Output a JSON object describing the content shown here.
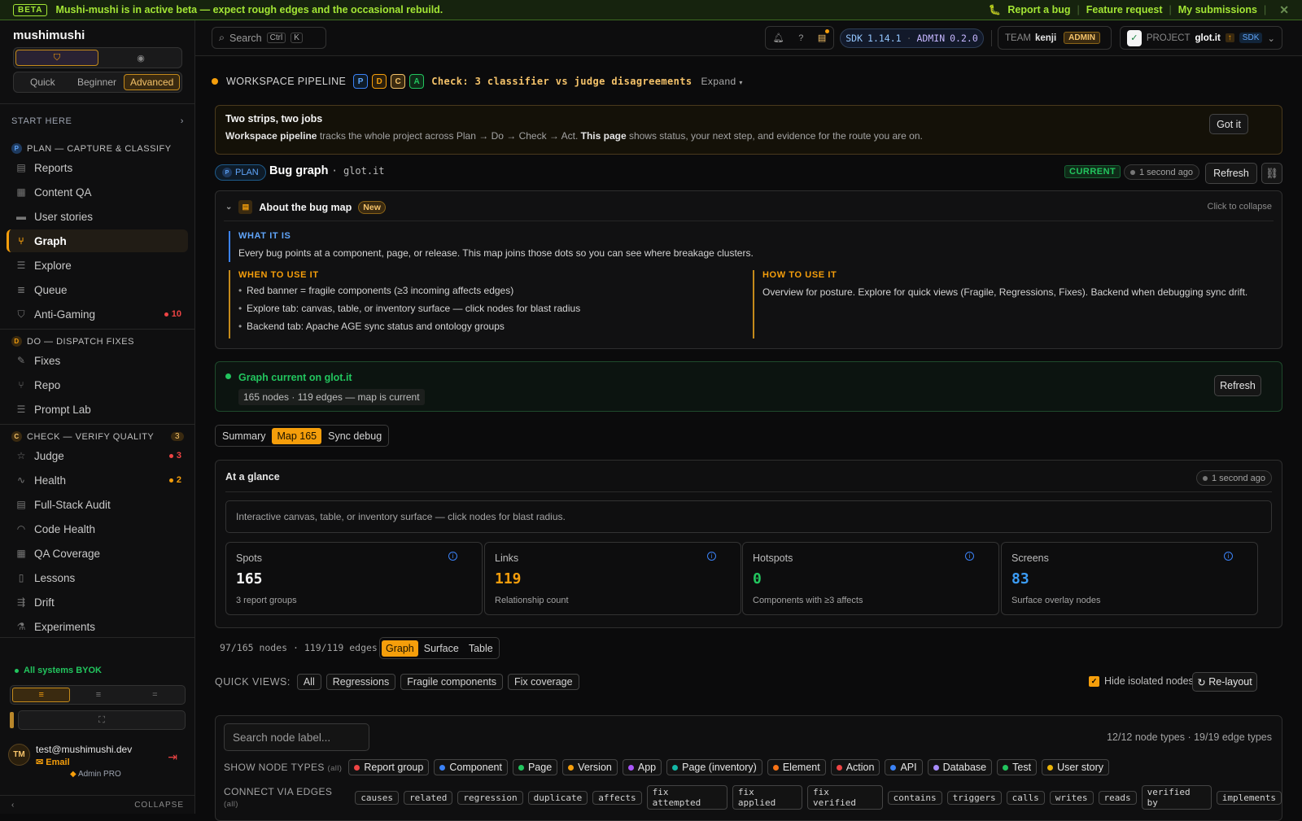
{
  "banner": {
    "tag": "BETA",
    "message": "Mushi-mushi is in active beta — expect rough edges and the occasional rebuild.",
    "links": [
      "Report a bug",
      "Feature request",
      "My submissions"
    ]
  },
  "sidebar": {
    "brand": "mushimushi",
    "difficulty": [
      "Quick",
      "Beginner",
      "Advanced"
    ],
    "start_here": "START HERE",
    "sections": [
      {
        "badge": "P",
        "label": "PLAN — CAPTURE & CLASSIFY",
        "items": [
          {
            "label": "Reports",
            "icon": "reports-icon"
          },
          {
            "label": "Content QA",
            "icon": "content-qa-icon"
          },
          {
            "label": "User stories",
            "icon": "user-stories-icon"
          },
          {
            "label": "Graph",
            "icon": "graph-icon",
            "active": true
          },
          {
            "label": "Explore",
            "icon": "explore-icon"
          },
          {
            "label": "Queue",
            "icon": "queue-icon"
          },
          {
            "label": "Anti-Gaming",
            "icon": "shield-icon",
            "count": "10",
            "count_color": "#ef4444"
          }
        ]
      },
      {
        "badge": "D",
        "label": "DO — DISPATCH FIXES",
        "items": [
          {
            "label": "Fixes",
            "icon": "wrench-icon"
          },
          {
            "label": "Repo",
            "icon": "branch-icon"
          },
          {
            "label": "Prompt Lab",
            "icon": "prompt-icon"
          }
        ]
      },
      {
        "badge": "C",
        "label": "CHECK — VERIFY QUALITY",
        "count": "3",
        "items": [
          {
            "label": "Judge",
            "icon": "star-icon",
            "count": "3",
            "count_color": "#ef4444"
          },
          {
            "label": "Health",
            "icon": "pulse-icon",
            "count": "2",
            "count_color": "#f59e0b"
          },
          {
            "label": "Full-Stack Audit",
            "icon": "audit-icon"
          },
          {
            "label": "Code Health",
            "icon": "gauge-icon"
          },
          {
            "label": "QA Coverage",
            "icon": "coverage-icon"
          },
          {
            "label": "Lessons",
            "icon": "book-icon"
          },
          {
            "label": "Drift",
            "icon": "drift-icon"
          },
          {
            "label": "Experiments",
            "icon": "flask-icon"
          }
        ]
      }
    ],
    "status": "All systems BYOK",
    "user": {
      "initials": "TM",
      "email": "test@mushimushi.dev",
      "provider": "Email",
      "plan": "Admin PRO"
    },
    "collapse": "COLLAPSE"
  },
  "topbar": {
    "search_label": "Search",
    "search_keys": [
      "Ctrl",
      "K"
    ],
    "sdk_label": "SDK",
    "sdk_version": "1.14.1",
    "admin_label": "ADMIN",
    "admin_version": "0.2.0",
    "team_label": "TEAM",
    "team_name": "kenji",
    "team_role": "ADMIN",
    "project_label": "PROJECT",
    "project_name": "glot.it",
    "project_sdk": "SDK"
  },
  "pipeline": {
    "label": "WORKSPACE PIPELINE",
    "stages": [
      "P",
      "D",
      "C",
      "A"
    ],
    "check_text": "Check: 3 classifier vs judge disagreements",
    "expand": "Expand"
  },
  "tip": {
    "title": "Two strips, two jobs",
    "b1": "Workspace pipeline",
    "t1": " tracks the whole project across Plan → Do → Check → Act. ",
    "b2": "This page",
    "t2": " shows status, your next step, and evidence for the route you are on.",
    "button": "Got it"
  },
  "page": {
    "plan_tag": "PLAN",
    "title": "Bug graph",
    "project": "· glot.it",
    "status": "CURRENT",
    "updated": "1 second ago",
    "refresh": "Refresh"
  },
  "about": {
    "title": "About the bug map",
    "badge": "New",
    "collapse_hint": "Click to collapse",
    "what_heading": "WHAT IT IS",
    "what_text": "Every bug points at a component, page, or release. This map joins those dots so you can see where breakage clusters.",
    "when_heading": "WHEN TO USE IT",
    "when_items": [
      "Red banner = fragile components (≥3 incoming affects edges)",
      "Explore tab: canvas, table, or inventory surface — click nodes for blast radius",
      "Backend tab: Apache AGE sync status and ontology groups"
    ],
    "how_heading": "HOW TO USE IT",
    "how_text": "Overview for posture. Explore for quick views (Fragile, Regressions, Fixes). Backend when debugging sync drift."
  },
  "graph_status": {
    "title": "Graph current on glot.it",
    "summary": "165 nodes · 119 edges — map is current",
    "refresh": "Refresh"
  },
  "tabs": [
    "Summary",
    "Map 165",
    "Sync debug"
  ],
  "glance": {
    "title": "At a glance",
    "updated": "1 second ago",
    "description": "Interactive canvas, table, or inventory surface — click nodes for blast radius.",
    "cards": [
      {
        "label": "Spots",
        "value": "165",
        "sub": "3 report groups",
        "color": "#f5f5f5"
      },
      {
        "label": "Links",
        "value": "119",
        "sub": "Relationship count",
        "color": "#f59e0b"
      },
      {
        "label": "Hotspots",
        "value": "0",
        "sub": "Components with ≥3 affects",
        "color": "#22c55e"
      },
      {
        "label": "Screens",
        "value": "83",
        "sub": "Surface overlay nodes",
        "color": "#3b9cf6"
      }
    ]
  },
  "map": {
    "stats": "97/165 nodes · 119/119 edges",
    "views": [
      "Graph",
      "Surface",
      "Table"
    ],
    "quick_label": "QUICK VIEWS:",
    "quick_views": [
      "All",
      "Regressions",
      "Fragile components",
      "Fix coverage"
    ],
    "hide_isolated": "Hide isolated nodes (68)",
    "relayout": "Re-layout",
    "search_placeholder": "Search node label...",
    "type_counts": "12/12 node types · 19/19 edge types",
    "node_types_label": "SHOW NODE TYPES",
    "all_hint": "(all)",
    "node_types": [
      {
        "label": "Report group",
        "color": "#ef4444"
      },
      {
        "label": "Component",
        "color": "#3b82f6"
      },
      {
        "label": "Page",
        "color": "#22c55e"
      },
      {
        "label": "Version",
        "color": "#f59e0b"
      },
      {
        "label": "App",
        "color": "#a855f7"
      },
      {
        "label": "Page (inventory)",
        "color": "#14b8a6"
      },
      {
        "label": "Element",
        "color": "#f97316"
      },
      {
        "label": "Action",
        "color": "#ef4444"
      },
      {
        "label": "API",
        "color": "#3b82f6"
      },
      {
        "label": "Database",
        "color": "#a78bfa"
      },
      {
        "label": "Test",
        "color": "#22c55e"
      },
      {
        "label": "User story",
        "color": "#eab308"
      }
    ],
    "edges_label": "CONNECT VIA EDGES",
    "edge_types": [
      "causes",
      "related",
      "regression",
      "duplicate",
      "affects",
      "fix attempted",
      "fix applied",
      "fix verified",
      "contains",
      "triggers",
      "calls",
      "writes",
      "reads",
      "verified by",
      "implements"
    ]
  }
}
